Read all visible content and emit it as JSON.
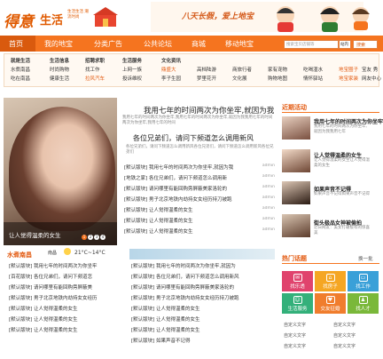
{
  "brand": {
    "logo_a": "得意",
    "logo_b": "生活",
    "logo_sub": "生活生活 潮流时尚",
    "slogan": "八天长假，爱上地宝"
  },
  "nav": {
    "items": [
      "首页",
      "我的地宝",
      "分类广告",
      "公共论坛",
      "商城",
      "移动地宝"
    ],
    "search_placeholder": "搜索宝贝店铺等",
    "search_select": "站内",
    "search_button": "搜索"
  },
  "categories": {
    "columns": [
      {
        "head": "就是生活",
        "items": [
          "水煮南昌",
          "吃在南昌"
        ]
      },
      {
        "head": "生活信息",
        "items": [
          "时尚购物",
          "健康生活"
        ]
      },
      {
        "head": "招聘求职",
        "items": [
          "找工作",
          "拉风汽车"
        ]
      },
      {
        "head": "生活服务",
        "items": [
          "上网一族",
          "投诉维权"
        ]
      },
      {
        "head": "文化资讯",
        "items": [
          "鼎盛大",
          "李子生园"
        ]
      },
      {
        "head": "",
        "items": [
          "高档陆游",
          "梦里花开"
        ]
      },
      {
        "head": "",
        "items": [
          "商旅行者",
          "文化展"
        ]
      },
      {
        "head": "",
        "items": [
          "家有宠物",
          "购物地图"
        ]
      },
      {
        "head": "",
        "items": [
          "吃喝湿水",
          "情怀驿站"
        ]
      },
      {
        "head": "",
        "items": [
          "地宝圈子",
          "地宝家装"
        ]
      },
      {
        "head": "",
        "items": [
          "宝友 秀",
          "网友中心"
        ]
      }
    ],
    "row0_extra": [
      "时尚购物",
      "找工作",
      "上网一族",
      "鼎盛大",
      "高档陆游"
    ]
  },
  "hero": {
    "caption": "让人觉得温柔的女生",
    "dots": [
      "1",
      "2",
      "3",
      "4"
    ]
  },
  "headlines": {
    "h1": "我用七年的时间两次为你坐牢,就因为我",
    "s1": "我用七年的时间两次为你坐牢,我用七年的时间两次为你坐牢,就因为我我用七年的时间两次为你坐牢,我用七年的时间",
    "h2": "各位兄弟们，请问下频道怎么调用新风",
    "s2": "各位兄弟们，请问下频道怎么调用新风各位兄弟们，请问下频道怎么调用新风各位兄弟们"
  },
  "news": [
    {
      "text": "[默认版块] 我用七年的时间两次为你坐牢,就因为我",
      "tail": "admin"
    },
    {
      "text": "[地铁之家] 各位兄弟们，请问下频道怎么调用新",
      "tail": "admin"
    },
    {
      "text": "[默认版块] 请问哪里有能回购旁屏蔽美家洛轮的",
      "tail": "admin"
    },
    {
      "text": "[默认版块] 男子北京地铁内劫持女女经历持刀被跑",
      "tail": "admin"
    },
    {
      "text": "[默认版块] 让人觉得温柔的女生",
      "tail": "admin"
    },
    {
      "text": "[默认版块] 让人觉得温柔的女生",
      "tail": "admin"
    },
    {
      "text": "[默认版块] 让人觉得温柔的女生",
      "tail": "admin"
    }
  ],
  "weather": {
    "city": "南昌",
    "temp": "21°C~14°C"
  },
  "water": {
    "title": "水煮南昌"
  },
  "left_rows": [
    "[默认版块] 我用七年的时间两次为你坐牢",
    "[百花版块] 各位兄弟们，请问下频道怎",
    "[默认版块] 请问哪里有能回购旁屏蔽美",
    "[默认版块] 男子北京地铁内劫持女女经历",
    "[默认版块] 让人觉得温柔的女生",
    "[默认版块] 让人觉得温柔的女生",
    "[默认版块] 让人觉得温柔的女生"
  ],
  "right_news": [
    "[默认版块] 我用七年的时间两次为你坐牢,就因为",
    "[默认版块] 各位兄弟们，请问下频道怎么调用新风",
    "[默认版块] 请问哪里有能回购旁屏蔽美家洛轮的",
    "[默认版块] 男子北京地铁内劫持女女经历持刀被跑",
    "[默认版块] 让人觉得温柔的女生",
    "[默认版块] 让人觉得温柔的女生",
    "[默认版块] 让人觉得温柔的女生",
    "[默认版块] 如果声音不记得"
  ],
  "activity": {
    "title": "近期活动",
    "items": [
      {
        "head": "我用七年的时间两次为你坐牢",
        "sub": "我用七年的时间两次为你坐牢,就因为我我用七年"
      },
      {
        "head": "让人觉得温柔的女生",
        "sub": "让人觉得温柔的女生让人觉得温柔的女生"
      },
      {
        "head": "如果声音不记得",
        "sub": "如果声音不记得如果声音不记得"
      },
      {
        "head": "街头极品女神被偷拍",
        "sub": "近日网友：美女打破极有的惊喜美"
      }
    ]
  },
  "hot": {
    "title": "热门话题",
    "more": "换一批",
    "tiles": [
      {
        "label": "找乐透",
        "icon": "✉",
        "color": "#e0436d"
      },
      {
        "label": "找房子",
        "icon": "⌂",
        "color": "#f5a623"
      },
      {
        "label": "找工作",
        "icon": "▭",
        "color": "#3aa0d8"
      },
      {
        "label": "生活服务",
        "icon": "☺",
        "color": "#33b07a"
      },
      {
        "label": "交友征婚",
        "icon": "♥",
        "color": "#f07d2d"
      },
      {
        "label": "找人才",
        "icon": "♟",
        "color": "#7ab83a"
      }
    ],
    "bottom": [
      "自定义文字",
      "自定义文字",
      "自定义文字",
      "自定义文字",
      "自定义文字",
      "自定义文字"
    ]
  },
  "colors": {
    "accent": "#f5741f",
    "title": "#e35b12"
  }
}
